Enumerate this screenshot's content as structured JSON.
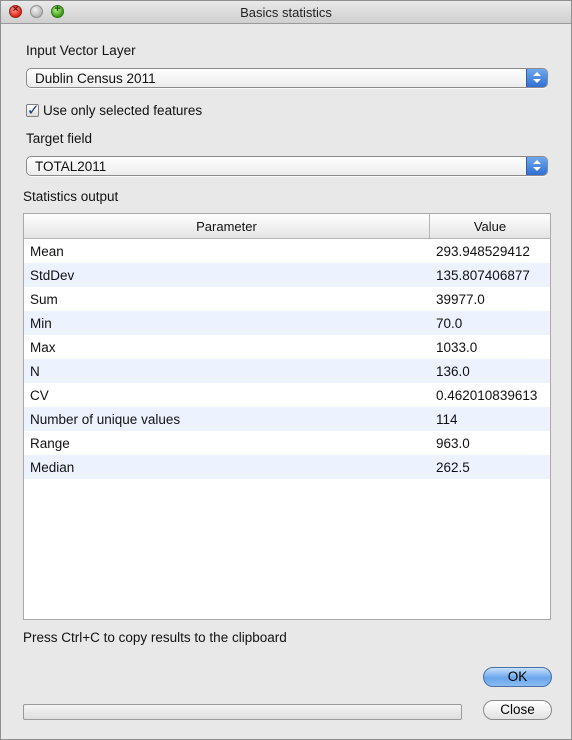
{
  "window": {
    "title": "Basics statistics"
  },
  "input_layer": {
    "label": "Input Vector Layer",
    "selected": "Dublin Census 2011"
  },
  "selected_features": {
    "label": "Use only selected features",
    "checked": true,
    "check_glyph": "✓"
  },
  "target_field": {
    "label": "Target field",
    "selected": "TOTAL2011"
  },
  "statistics": {
    "label": "Statistics output",
    "columns": {
      "parameter": "Parameter",
      "value": "Value"
    },
    "rows": [
      {
        "parameter": "Mean",
        "value": "293.948529412"
      },
      {
        "parameter": "StdDev",
        "value": "135.807406877"
      },
      {
        "parameter": "Sum",
        "value": "39977.0"
      },
      {
        "parameter": "Min",
        "value": "70.0"
      },
      {
        "parameter": "Max",
        "value": "1033.0"
      },
      {
        "parameter": "N",
        "value": "136.0"
      },
      {
        "parameter": "CV",
        "value": "0.462010839613"
      },
      {
        "parameter": "Number of unique values",
        "value": "114"
      },
      {
        "parameter": "Range",
        "value": "963.0"
      },
      {
        "parameter": "Median",
        "value": "262.5"
      }
    ]
  },
  "hint": "Press Ctrl+C to copy results to the clipboard",
  "buttons": {
    "ok": "OK",
    "close": "Close"
  },
  "progress": {
    "value": 0
  },
  "colors": {
    "accent": "#6aa6ec",
    "alt_row": "#edf3fe",
    "window_bg": "#e8e8e8"
  },
  "icons": {
    "close": "close-icon",
    "minimize": "minimize-icon",
    "zoom": "zoom-icon"
  }
}
